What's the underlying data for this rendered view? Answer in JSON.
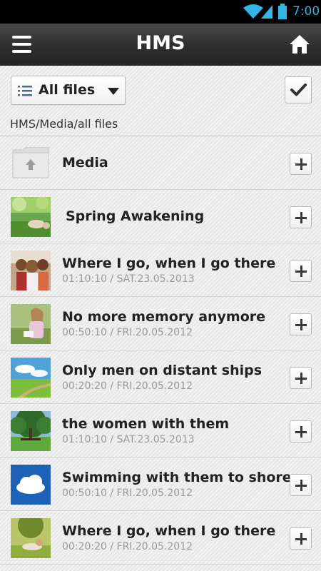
{
  "status_bar": {
    "time": "7:00",
    "icons": [
      "wifi-icon",
      "signal-icon",
      "battery-icon"
    ],
    "accent_color": "#33b5e5"
  },
  "action_bar": {
    "title": "HMS",
    "left_icon": "menu-icon",
    "right_icon": "home-icon"
  },
  "toolbar": {
    "filter_label": "All files",
    "filter_icon": "list-icon",
    "select_icon": "checkmark-icon"
  },
  "breadcrumb": "HMS/Media/all files",
  "files": [
    {
      "title": "Media",
      "meta": "",
      "kind": "folder"
    },
    {
      "title": "Spring Awakening",
      "meta": "",
      "kind": "image"
    },
    {
      "title": "Where I go, when I go there",
      "meta": "01:10:10 / SAT.23.05.2013",
      "kind": "image"
    },
    {
      "title": "No more memory anymore",
      "meta": "00:50:10 / FRI.20.05.2012",
      "kind": "image"
    },
    {
      "title": "Only men on distant ships",
      "meta": "00:20:20 / FRI.20.05.2012",
      "kind": "image"
    },
    {
      "title": "the women with them",
      "meta": "01:10:10 / SAT.23.05.2013",
      "kind": "image"
    },
    {
      "title": "Swimming with them to shore",
      "meta": "00:50:10 / FRI.20.05.2012",
      "kind": "image"
    },
    {
      "title": "Where I go, when I go there",
      "meta": "00:20:20 / FRI.20.05.2012",
      "kind": "image"
    }
  ]
}
